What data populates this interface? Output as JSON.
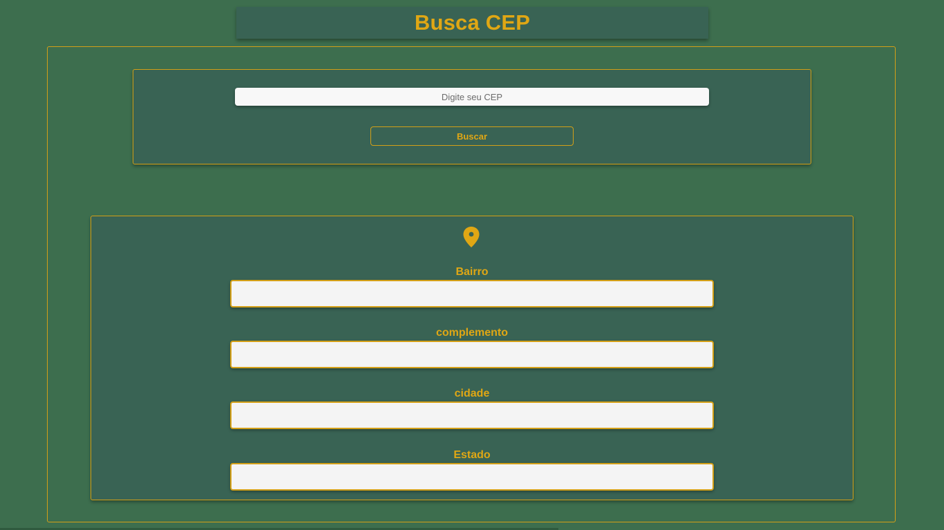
{
  "header": {
    "title": "Busca CEP"
  },
  "search": {
    "placeholder": "Digite seu CEP",
    "value": "",
    "button_label": "Buscar"
  },
  "result": {
    "icon": "map-pin-icon",
    "fields": [
      {
        "label": "Bairro",
        "value": ""
      },
      {
        "label": "complemento",
        "value": ""
      },
      {
        "label": "cidade",
        "value": ""
      },
      {
        "label": "Estado",
        "value": ""
      }
    ]
  },
  "colors": {
    "background": "#3d6e4e",
    "panel": "#396354",
    "accent": "#e0a714",
    "border": "#d4a017",
    "input_background": "#f4f4f4"
  }
}
